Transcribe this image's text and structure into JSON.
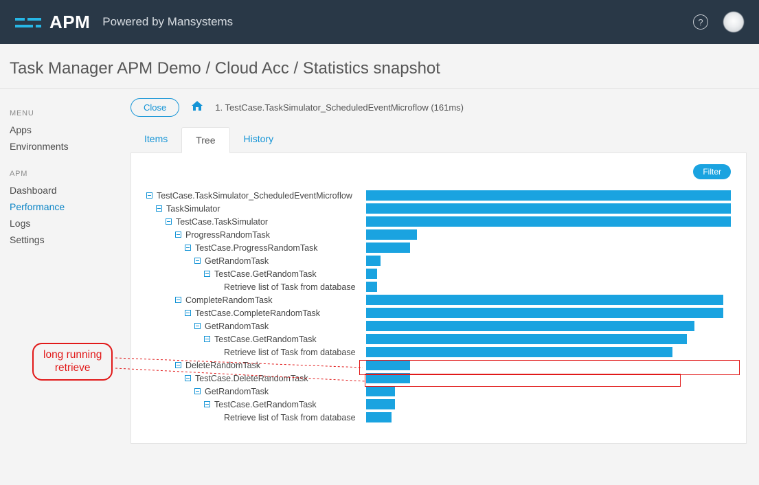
{
  "brand": "APM",
  "subbrand": "Powered by Mansystems",
  "breadcrumb": "Task Manager APM Demo / Cloud Acc / Statistics snapshot",
  "menu": {
    "heading1": "MENU",
    "items1": [
      "Apps",
      "Environments"
    ],
    "heading2": "APM",
    "items2": [
      "Dashboard",
      "Performance",
      "Logs",
      "Settings"
    ],
    "activeItem": "Performance"
  },
  "toolbar": {
    "close_label": "Close",
    "path": "1. TestCase.TaskSimulator_ScheduledEventMicroflow (161ms)"
  },
  "tabs": [
    "Items",
    "Tree",
    "History"
  ],
  "activeTab": "Tree",
  "filter_label": "Filter",
  "annotation": "long running\nretrieve",
  "chart_data": {
    "type": "bar",
    "title": "",
    "xlabel": "",
    "ylabel": "",
    "unit": "percent_of_max",
    "series": [
      {
        "indent": 0,
        "exp": true,
        "label": "TestCase.TaskSimulator_ScheduledEventMicroflow",
        "value": 100
      },
      {
        "indent": 1,
        "exp": true,
        "label": "TaskSimulator",
        "value": 100
      },
      {
        "indent": 2,
        "exp": true,
        "label": "TestCase.TaskSimulator",
        "value": 100
      },
      {
        "indent": 3,
        "exp": true,
        "label": "ProgressRandomTask",
        "value": 14
      },
      {
        "indent": 4,
        "exp": true,
        "label": "TestCase.ProgressRandomTask",
        "value": 12
      },
      {
        "indent": 5,
        "exp": true,
        "label": "GetRandomTask",
        "value": 4
      },
      {
        "indent": 6,
        "exp": true,
        "label": "TestCase.GetRandomTask",
        "value": 3
      },
      {
        "indent": 7,
        "exp": false,
        "label": "Retrieve list of Task from database",
        "value": 3
      },
      {
        "indent": 3,
        "exp": true,
        "label": "CompleteRandomTask",
        "value": 98
      },
      {
        "indent": 4,
        "exp": true,
        "label": "TestCase.CompleteRandomTask",
        "value": 98
      },
      {
        "indent": 5,
        "exp": true,
        "label": "GetRandomTask",
        "value": 90
      },
      {
        "indent": 6,
        "exp": true,
        "label": "TestCase.GetRandomTask",
        "value": 88
      },
      {
        "indent": 7,
        "exp": false,
        "label": "Retrieve list of Task from database",
        "value": 84
      },
      {
        "indent": 3,
        "exp": true,
        "label": "DeleteRandomTask",
        "value": 12
      },
      {
        "indent": 4,
        "exp": true,
        "label": "TestCase.DeleteRandomTask",
        "value": 12
      },
      {
        "indent": 5,
        "exp": true,
        "label": "GetRandomTask",
        "value": 8
      },
      {
        "indent": 6,
        "exp": true,
        "label": "TestCase.GetRandomTask",
        "value": 8
      },
      {
        "indent": 7,
        "exp": false,
        "label": "Retrieve list of Task from database",
        "value": 7
      }
    ]
  }
}
